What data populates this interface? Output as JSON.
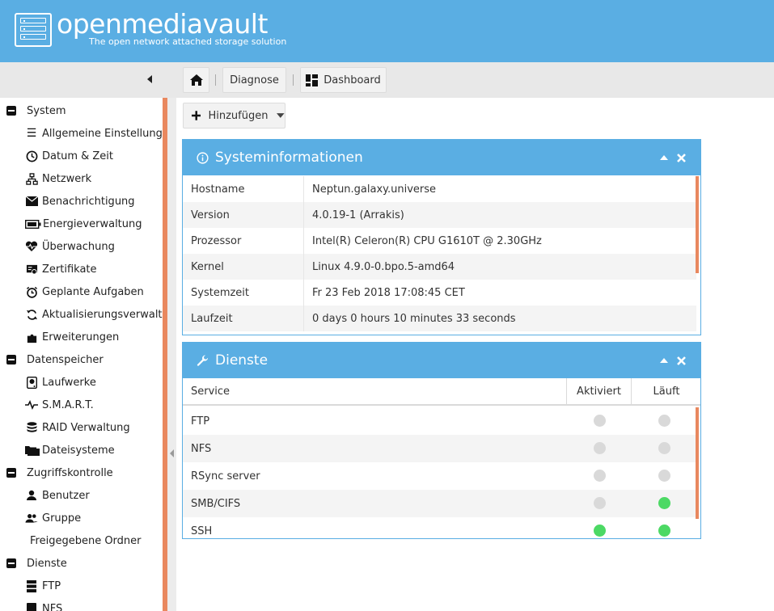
{
  "header": {
    "brand": "openmediavault",
    "tagline": "The open network attached storage solution",
    "color": "#5aaee3"
  },
  "toolbar": {
    "home_icon": "home-icon",
    "breadcrumb": [
      "Diagnose",
      "Dashboard"
    ],
    "dashboard_icon": "dashboard-icon"
  },
  "sidebar": {
    "groups": [
      {
        "label": "System",
        "items": [
          {
            "label": "Allgemeine Einstellungen",
            "icon": "sliders-icon"
          },
          {
            "label": "Datum & Zeit",
            "icon": "clock-icon"
          },
          {
            "label": "Netzwerk",
            "icon": "network-icon"
          },
          {
            "label": "Benachrichtigung",
            "icon": "envelope-icon"
          },
          {
            "label": "Energieverwaltung",
            "icon": "battery-icon"
          },
          {
            "label": "Überwachung",
            "icon": "heartbeat-icon"
          },
          {
            "label": "Zertifikate",
            "icon": "certificate-icon"
          },
          {
            "label": "Geplante Aufgaben",
            "icon": "alarm-clock-icon"
          },
          {
            "label": "Aktualisierungsverwaltun",
            "icon": "refresh-icon"
          },
          {
            "label": "Erweiterungen",
            "icon": "puzzle-icon"
          }
        ]
      },
      {
        "label": "Datenspeicher",
        "items": [
          {
            "label": "Laufwerke",
            "icon": "harddisk-icon"
          },
          {
            "label": "S.M.A.R.T.",
            "icon": "pulse-icon"
          },
          {
            "label": "RAID Verwaltung",
            "icon": "database-icon"
          },
          {
            "label": "Dateisysteme",
            "icon": "folders-icon"
          }
        ]
      },
      {
        "label": "Zugriffskontrolle",
        "items": [
          {
            "label": "Benutzer",
            "icon": "user-icon"
          },
          {
            "label": "Gruppe",
            "icon": "users-icon"
          },
          {
            "label": "Freigegebene Ordner",
            "icon": ""
          }
        ]
      },
      {
        "label": "Dienste",
        "items": [
          {
            "label": "FTP",
            "icon": "server-icon"
          },
          {
            "label": "NFS",
            "icon": "server-icon"
          }
        ]
      }
    ]
  },
  "actions": {
    "add_label": "Hinzufügen"
  },
  "sysinfo": {
    "title": "Systeminformationen",
    "rows": [
      {
        "key": "Hostname",
        "value": "Neptun.galaxy.universe"
      },
      {
        "key": "Version",
        "value": "4.0.19-1 (Arrakis)"
      },
      {
        "key": "Prozessor",
        "value": "Intel(R) Celeron(R) CPU G1610T @ 2.30GHz"
      },
      {
        "key": "Kernel",
        "value": "Linux 4.9.0-0.bpo.5-amd64"
      },
      {
        "key": "Systemzeit",
        "value": "Fr 23 Feb 2018 17:08:45 CET"
      },
      {
        "key": "Laufzeit",
        "value": "0 days 0 hours 10 minutes 33 seconds"
      }
    ]
  },
  "services": {
    "title": "Dienste",
    "columns": [
      "Service",
      "Aktiviert",
      "Läuft"
    ],
    "rows": [
      {
        "name": "FTP",
        "enabled": false,
        "running": false
      },
      {
        "name": "NFS",
        "enabled": false,
        "running": false
      },
      {
        "name": "RSync server",
        "enabled": false,
        "running": false
      },
      {
        "name": "SMB/CIFS",
        "enabled": false,
        "running": true
      },
      {
        "name": "SSH",
        "enabled": true,
        "running": true
      }
    ],
    "on_color": "#4cd964",
    "off_color": "#d9d9d9"
  }
}
